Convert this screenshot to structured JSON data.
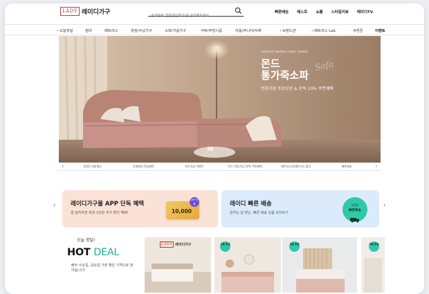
{
  "header": {
    "logo_box": "LADY",
    "logo_text": "레이디가구",
    "search_placeholder": "검색창에 '연말결산특가'를 검색해보세요",
    "util_nav": [
      "빠른배송",
      "베스트",
      "쇼룸",
      "스타일리뷰",
      "레이디TV"
    ]
  },
  "category_nav": [
    {
      "label": "오늘핫딜",
      "dot": true
    },
    {
      "label": "침대",
      "dot": false
    },
    {
      "label": "매트리스",
      "dot": false
    },
    {
      "label": "옷장/수납가구",
      "dot": false
    },
    {
      "label": "소파/거실가구",
      "dot": false
    },
    {
      "label": "식탁/주방시공",
      "dot": false
    },
    {
      "label": "아동/주니어/서재",
      "dot": false
    },
    {
      "label": "브랜드관",
      "dot": true
    },
    {
      "label": "매트리스 Lab.",
      "dot": true
    },
    {
      "label": "쿠폰존",
      "dot": false
    },
    {
      "label": "이벤트",
      "dot": false
    }
  ],
  "hero": {
    "script_top": "natural leather sofa, mond",
    "title_line1": "몬드",
    "title_line2": "통가죽소파",
    "script_overlay": "Sofa",
    "subtitle": "런칭기념 프로모션 & 단독 10% 쿠폰혜택"
  },
  "slider_tabs": {
    "prev": "‹",
    "next": "›",
    "tabs": [
      "2022 연말결산",
      "모델침대 런칭혜택",
      "포토리뷰 이벤트",
      "몬드 런칭기념 10% 쿠폰혜택",
      "매트리스/투매트리스 할인",
      "빠른배송"
    ]
  },
  "banners": {
    "prev": "‹",
    "next": "›",
    "app": {
      "title": "레이디가구몰 APP 단독 혜택",
      "desc": "앱 설치하면 최대 1만원 추가 할인 혜택!",
      "coupon_value": "10,000",
      "coupon_badge": "APP 전용"
    },
    "ship": {
      "title": "레이디 빠른 배송",
      "desc": "원하는 날 받는, 빠른 배송 상품 모아보기",
      "badge_line1": "지정일",
      "badge_line2": "빠른배송"
    }
  },
  "hot_deal": {
    "pre": "오늘 핫딜!",
    "title_hot": "HOT",
    "title_deal": "DEAL",
    "desc": "빠주 수요일, 금요일 가장 좋은 가격으로 찾아옵니다!",
    "products": [
      {
        "badge": "",
        "logo_box": "LADY",
        "logo_text": "레이디가구"
      },
      {
        "badge": "오늘 핫딜"
      },
      {
        "badge": "오늘 핫딜"
      },
      {
        "badge": "오늘 핫딜"
      }
    ]
  },
  "colors": {
    "brand_red": "#c43a3a",
    "accent_mint": "#2fc9a8",
    "app_banner_bg": "#fbe2d7",
    "ship_banner_bg": "#dcebfb"
  }
}
